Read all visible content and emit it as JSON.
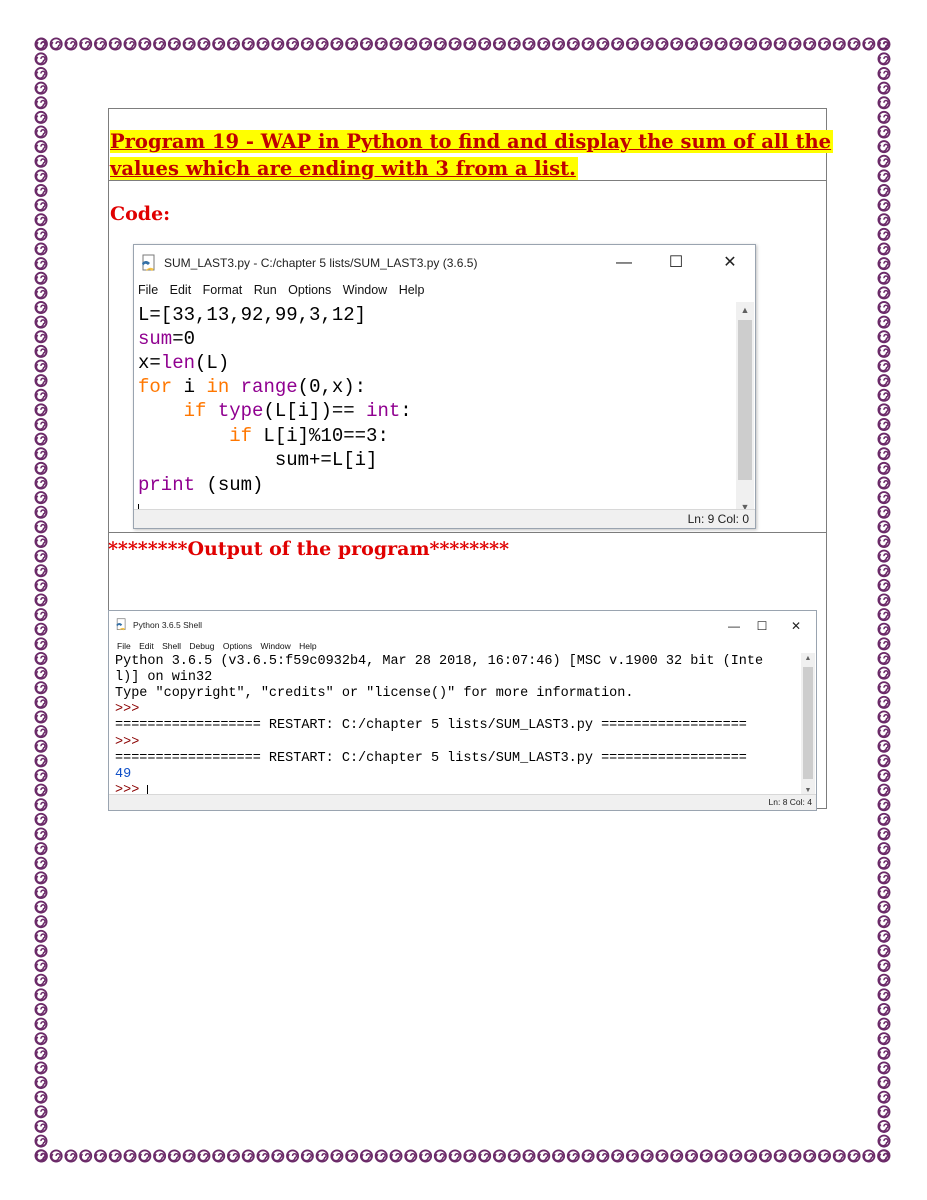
{
  "colors": {
    "border_swirl": "#6b2a68",
    "title_text": "#c00000",
    "title_highlight": "#ffff00",
    "label_red": "#e00000",
    "keyword": "#ff7700",
    "builtin": "#900090",
    "output_blue": "#1050c8",
    "prompt": "#8b0000"
  },
  "document": {
    "title_line1": "Program 19 - WAP in Python  to find and display the sum of all the",
    "title_line2": "values which are ending with  3  from a list.",
    "code_label": "Code:",
    "output_label": "********Output of the program********"
  },
  "editor": {
    "icon": "python-file-icon",
    "title": "SUM_LAST3.py - C:/chapter 5 lists/SUM_LAST3.py (3.6.5)",
    "controls": {
      "minimize": "—",
      "maximize": "☐",
      "close": "✕"
    },
    "menu": [
      "File",
      "Edit",
      "Format",
      "Run",
      "Options",
      "Window",
      "Help"
    ],
    "code": {
      "l1": "L=[33,13,92,99,3,12]",
      "l2_kw": "sum",
      "l2_rest": "=0",
      "l3_pre": "x=",
      "l3_kw": "len",
      "l3_rest": "(L)",
      "l4_for": "for",
      "l4_mid": " i ",
      "l4_in": "in",
      "l4_sp": " ",
      "l4_range": "range",
      "l4_rest": "(0,x):",
      "l5_indent": "    ",
      "l5_if": "if",
      "l5_sp": " ",
      "l5_type": "type",
      "l5_mid": "(L[i])== ",
      "l5_int": "int",
      "l5_rest": ":",
      "l6_indent": "        ",
      "l6_if": "if",
      "l6_rest": " L[i]%10==3:",
      "l7_indent": "            ",
      "l7_text": "sum+=L[i]",
      "l8_print": "print",
      "l8_rest": " (sum)"
    },
    "status": "Ln: 9   Col: 0"
  },
  "shell": {
    "icon": "python-shell-icon",
    "title": "Python 3.6.5 Shell",
    "controls": {
      "minimize": "—",
      "maximize": "☐",
      "close": "✕"
    },
    "menu": [
      "File",
      "Edit",
      "Shell",
      "Debug",
      "Options",
      "Window",
      "Help"
    ],
    "lines": {
      "l1": "Python 3.6.5 (v3.6.5:f59c0932b4, Mar 28 2018, 16:07:46) [MSC v.1900 32 bit (Inte",
      "l2": "l)] on win32",
      "l3": "Type \"copyright\", \"credits\" or \"license()\" for more information.",
      "l4": ">>> ",
      "l5": "================== RESTART: C:/chapter 5 lists/SUM_LAST3.py ==================",
      "l6": ">>> ",
      "l7": "================== RESTART: C:/chapter 5 lists/SUM_LAST3.py ==================",
      "l8": "49",
      "l9": ">>> "
    },
    "status": "Ln: 8   Col: 4"
  }
}
